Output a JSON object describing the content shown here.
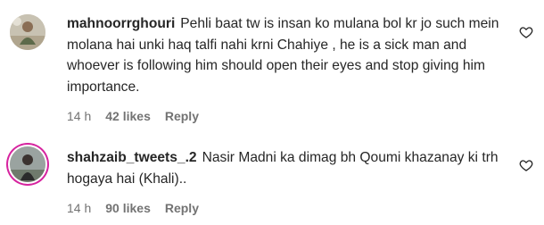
{
  "comments": [
    {
      "username": "mahnoorrghouri",
      "text": "Pehli baat tw is insan ko mulana bol kr jo such mein molana hai unki haq talfi nahi krni Chahiye , he is a sick man and whoever is following him should open their eyes and stop giving him importance.",
      "time": "14 h",
      "likes": "42 likes",
      "reply": "Reply",
      "avatar_icon": "user-avatar-outdoor-photo"
    },
    {
      "username": "shahzaib_tweets_.2",
      "text": "Nasir Madni ka dimag bh Qoumi khazanay ki trh hogaya hai (Khali)..",
      "time": "14 h",
      "likes": "90 likes",
      "reply": "Reply",
      "avatar_icon": "user-avatar-story-ring"
    }
  ],
  "icons": {
    "like": "heart-outline-icon"
  },
  "colors": {
    "text": "#262626",
    "meta": "#737373",
    "story_ring": "#d6249f"
  }
}
